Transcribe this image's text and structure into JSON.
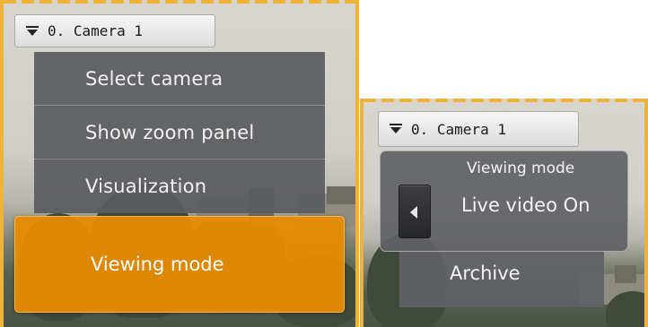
{
  "left_panel": {
    "camera_selector": {
      "label": "0. Camera 1",
      "icon": "dropdown-arrow-icon"
    },
    "menu_items": [
      {
        "label": "Select camera"
      },
      {
        "label": "Show zoom panel"
      },
      {
        "label": "Visualization"
      }
    ],
    "highlighted_item": {
      "label": "Viewing mode"
    }
  },
  "right_panel": {
    "camera_selector": {
      "label": "0. Camera 1",
      "icon": "dropdown-arrow-icon"
    },
    "viewing_mode": {
      "title": "Viewing mode",
      "value": "Live video On",
      "back_icon": "left-arrow-icon"
    },
    "archive_item": {
      "label": "Archive"
    }
  },
  "colors": {
    "frame_border": "#f1b23a",
    "highlight": "#ea8c00",
    "menu_bg": "#5a5b60"
  }
}
